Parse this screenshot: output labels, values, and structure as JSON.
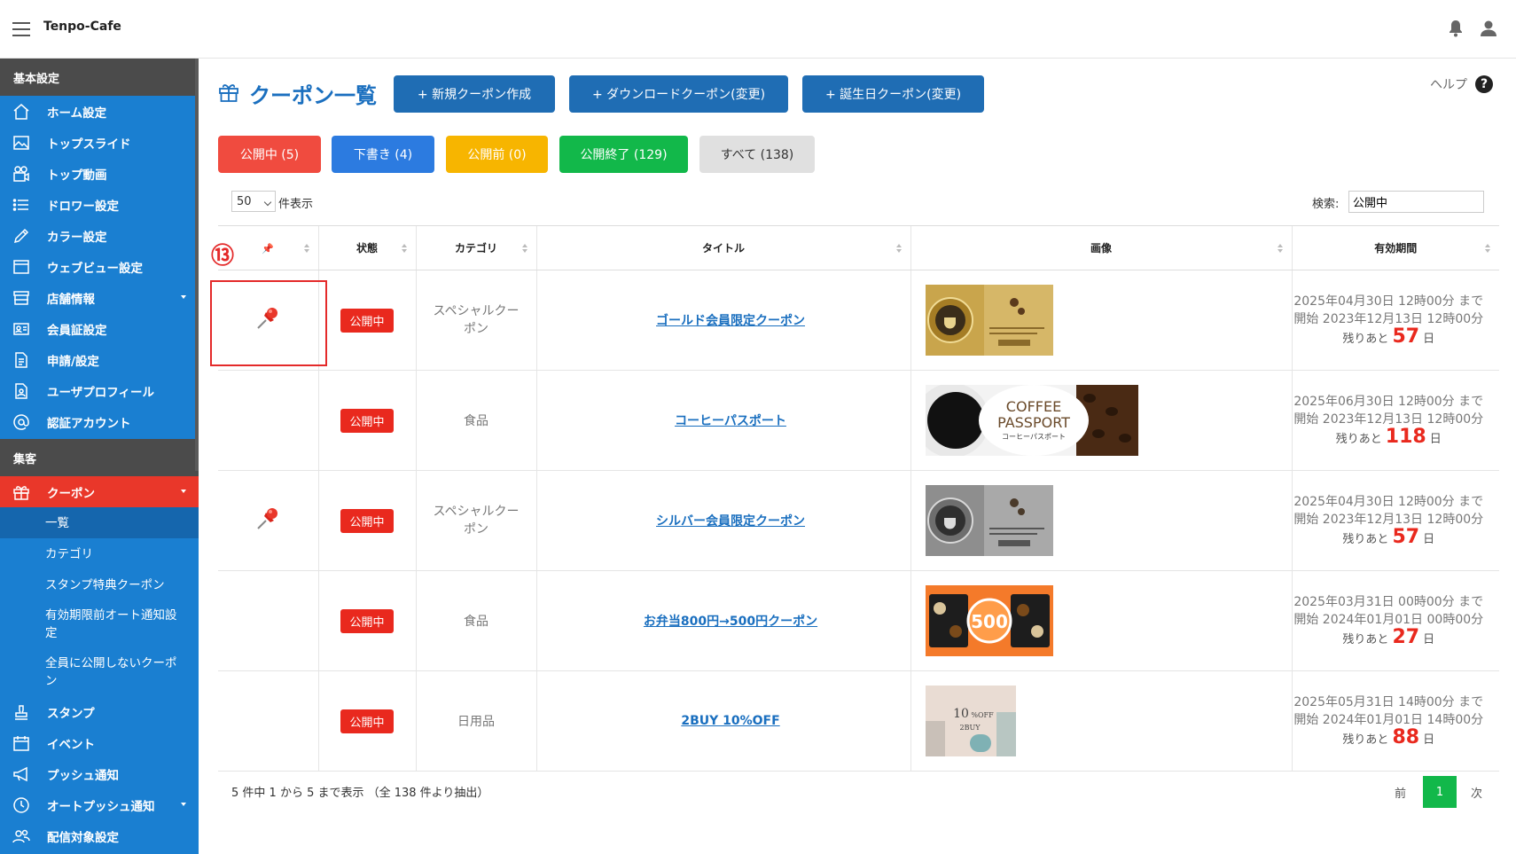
{
  "app": {
    "title": "Tenpo-Cafe"
  },
  "sidebar": {
    "sections": [
      "基本設定",
      "集客"
    ],
    "basic_items": [
      {
        "label": "ホーム設定",
        "icon": "home-icon"
      },
      {
        "label": "トップスライド",
        "icon": "image-icon"
      },
      {
        "label": "トップ動画",
        "icon": "video-icon"
      },
      {
        "label": "ドロワー設定",
        "icon": "list-icon"
      },
      {
        "label": "カラー設定",
        "icon": "pencil-icon"
      },
      {
        "label": "ウェブビュー設定",
        "icon": "browser-icon"
      },
      {
        "label": "店舗情報",
        "icon": "store-icon"
      },
      {
        "label": "会員証設定",
        "icon": "id-card-icon"
      },
      {
        "label": "申請/設定",
        "icon": "document-icon"
      },
      {
        "label": "ユーザプロフィール",
        "icon": "profile-icon"
      },
      {
        "label": "認証アカウント",
        "icon": "at-icon"
      }
    ],
    "coupon": {
      "label": "クーポン",
      "icon": "gift-icon"
    },
    "coupon_sub": [
      "一覧",
      "カテゴリ",
      "スタンプ特典クーポン",
      "有効期限前オート通知設定",
      "全員に公開しないクーポン"
    ],
    "attract_items": [
      {
        "label": "スタンプ",
        "icon": "stamp-icon"
      },
      {
        "label": "イベント",
        "icon": "calendar-icon"
      },
      {
        "label": "プッシュ通知",
        "icon": "megaphone-icon"
      },
      {
        "label": "オートプッシュ通知",
        "icon": "clock-icon"
      },
      {
        "label": "配信対象設定",
        "icon": "users-icon"
      }
    ]
  },
  "header": {
    "title": "クーポン一覧",
    "buttons": [
      "+ 新規クーポン作成",
      "+ ダウンロードクーポン(変更)",
      "+ 誕生日クーポン(変更)"
    ],
    "help": "ヘルプ"
  },
  "filters": [
    {
      "label": "公開中 (5)",
      "color": "#f04b3f"
    },
    {
      "label": "下書き (4)",
      "color": "#2c7be0"
    },
    {
      "label": "公開前 (0)",
      "color": "#f7b500"
    },
    {
      "label": "公開終了 (129)",
      "color": "#12b84a"
    },
    {
      "label": "すべて (138)",
      "color": "#e0e0e0"
    }
  ],
  "controls": {
    "length_value": "50",
    "length_label": "件表示",
    "search_label": "検索:",
    "search_value": "公開中"
  },
  "table": {
    "columns": [
      "",
      "状態",
      "カテゴリ",
      "タイトル",
      "画像",
      "有効期間"
    ],
    "rows": [
      {
        "pinned": true,
        "status": "公開中",
        "category": "スペシャルクーポン",
        "title": "ゴールド会員限定クーポン",
        "period_end": "2025年04月30日 12時00分 まで",
        "period_start": "開始 2023年12月13日 12時00分",
        "remain_prefix": "残りあと",
        "days": "57",
        "remain_suffix": "日"
      },
      {
        "pinned": false,
        "status": "公開中",
        "category": "食品",
        "title": "コーヒーパスポート",
        "period_end": "2025年06月30日 12時00分 まで",
        "period_start": "開始 2023年12月13日 12時00分",
        "remain_prefix": "残りあと",
        "days": "118",
        "remain_suffix": "日"
      },
      {
        "pinned": true,
        "status": "公開中",
        "category": "スペシャルクーポン",
        "title": "シルバー会員限定クーポン",
        "period_end": "2025年04月30日 12時00分 まで",
        "period_start": "開始 2023年12月13日 12時00分",
        "remain_prefix": "残りあと",
        "days": "57",
        "remain_suffix": "日"
      },
      {
        "pinned": false,
        "status": "公開中",
        "category": "食品",
        "title": "お弁当800円→500円クーポン",
        "period_end": "2025年03月31日 00時00分 まで",
        "period_start": "開始 2024年01月01日 00時00分",
        "remain_prefix": "残りあと",
        "days": "27",
        "remain_suffix": "日"
      },
      {
        "pinned": false,
        "status": "公開中",
        "category": "日用品",
        "title": "2BUY 10%OFF",
        "period_end": "2025年05月31日 14時00分 まで",
        "period_start": "開始 2024年01月01日 14時00分",
        "remain_prefix": "残りあと",
        "days": "88",
        "remain_suffix": "日"
      }
    ]
  },
  "images": {
    "coffee_1": "COFFEE",
    "coffee_2": "PASSPORT",
    "coffee_3": "コーヒーパスポート",
    "bento": "500",
    "buy_10": "10",
    "buy_off": "%OFF",
    "buy_2": "2BUY"
  },
  "annotation": "⑬",
  "footer": {
    "info": "5 件中 1 から 5 まで表示 （全 138 件より抽出）",
    "prev": "前",
    "page": "1",
    "next": "次"
  }
}
